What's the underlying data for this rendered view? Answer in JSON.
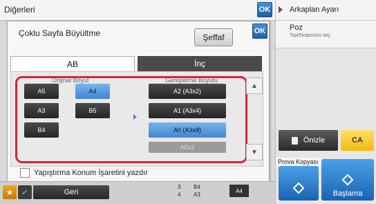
{
  "header": {
    "title": "Diğerleri",
    "ok_label": "OK"
  },
  "right_panel": {
    "background_label": "Arkaplan Ayarı",
    "poz_label": "Poz",
    "poz_sub": "Tipi/Ekspozürü seç",
    "preview_label": "Önizle",
    "ca_label": "CA",
    "proof_label": "Prova Kopyası",
    "start_label": "Başlama"
  },
  "dialog": {
    "title": "Çoklu Sayfa Büyültme",
    "ok_label": "OK",
    "transparent_label": "Şeffaf",
    "tabs": [
      {
        "label": "AB",
        "active": true
      },
      {
        "label": "İnç",
        "active": false
      }
    ],
    "original_size_label": "Orijinal Boyut",
    "enlarged_size_label": "Genişletme Boyutu",
    "original_sizes": [
      {
        "label": "A5",
        "selected": false
      },
      {
        "label": "A4",
        "selected": true
      },
      {
        "label": "A3",
        "selected": false
      },
      {
        "label": "B5",
        "selected": false
      },
      {
        "label": "B4",
        "selected": false
      }
    ],
    "enlarged_sizes": [
      {
        "label": "A2 (A3x2)",
        "selected": false
      },
      {
        "label": "A1 (A3x4)",
        "selected": false
      },
      {
        "label": "A0 (A3x8)",
        "selected": true
      },
      {
        "label": "A0x2",
        "selected": false,
        "dimmed": true
      }
    ],
    "checkbox_label": "Yapıştırma Konum İşaretini yazdır"
  },
  "bottom_bar": {
    "back_label": "Geri",
    "info": {
      "row1_left": "3",
      "row1_right": "B4",
      "row2_left": "4",
      "row2_right": "A3"
    },
    "paper_badge": "A4"
  },
  "colors": {
    "accent_blue": "#3e86d4",
    "highlight_red": "#d8253a",
    "ca_yellow": "#f2bb10",
    "star_orange": "#f3a31e"
  }
}
